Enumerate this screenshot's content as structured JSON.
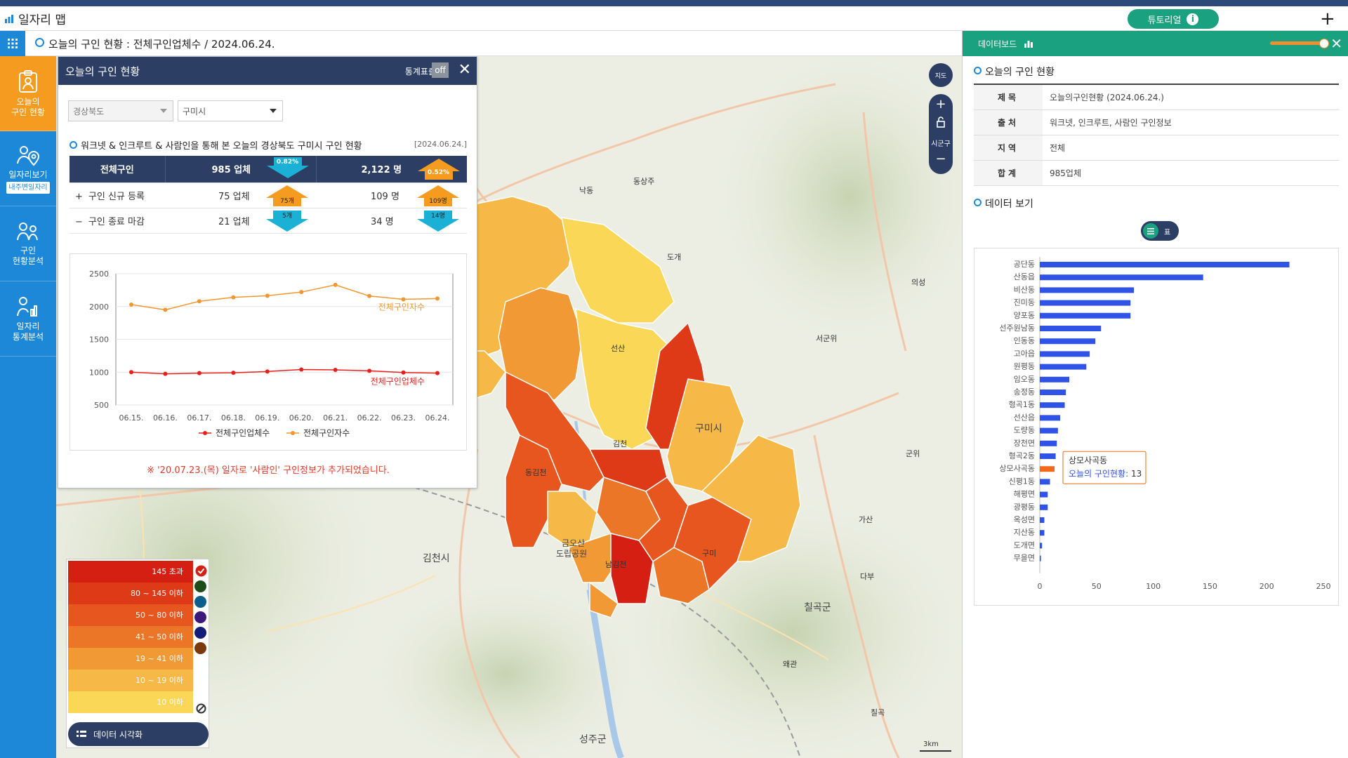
{
  "app": {
    "title": "일자리 맵",
    "tutorial_label": "튜토리얼",
    "info_icon": "i"
  },
  "breadcrumb": "오늘의 구인 현황 : 전체구인업체수 / 2024.06.24.",
  "sidebar": {
    "items": [
      {
        "label1": "오늘의",
        "label2": "구인 현황"
      },
      {
        "label1": "일자리보기",
        "badge": "내주변일자리"
      },
      {
        "label1": "구인",
        "label2": "현황분석"
      },
      {
        "label1": "일자리",
        "label2": "통계분석"
      }
    ]
  },
  "panel": {
    "title": "오늘의 구인 현황",
    "stat_label": "통계표출",
    "stat_toggle": "off",
    "region1": "경상북도",
    "region2": "구미시",
    "subtitle": "워크넷 & 인크루트 & 사람인을 통해 본 오늘의 경상북도 구미시 구인 현황",
    "date": "[2024.06.24.]",
    "table": {
      "header": {
        "label": "전체구인",
        "firms": "985 업체",
        "firms_change": "0.82%",
        "people": "2,122 명",
        "people_change": "0.52%"
      },
      "rows": [
        {
          "sign": "+",
          "label": "구인 신규 등록",
          "firms": "75 업체",
          "firms_badge": "75개",
          "people": "109 명",
          "people_badge": "109명"
        },
        {
          "sign": "−",
          "label": "구인 종료 마감",
          "firms": "21 업체",
          "firms_badge": "5개",
          "people": "34 명",
          "people_badge": "14명"
        }
      ]
    },
    "notice": "※ '20.07.23.(목) 일자로 '사람인' 구인정보가 추가되었습니다."
  },
  "chart_data": [
    {
      "type": "line",
      "categories": [
        "06.15.",
        "06.16.",
        "06.17.",
        "06.18.",
        "06.19.",
        "06.20.",
        "06.21.",
        "06.22.",
        "06.23.",
        "06.24."
      ],
      "series": [
        {
          "name": "전체구인업체수",
          "values": [
            1000,
            975,
            985,
            990,
            1010,
            1040,
            1035,
            1020,
            995,
            985
          ],
          "color": "#e8201c"
        },
        {
          "name": "전체구인자수",
          "values": [
            2030,
            1950,
            2080,
            2140,
            2165,
            2220,
            2330,
            2160,
            2110,
            2122
          ],
          "color": "#f2962f"
        }
      ],
      "yticks": [
        500,
        1000,
        1500,
        2000,
        2500
      ],
      "ylim": [
        500,
        2500
      ],
      "legend_position": "bottom",
      "grid": true
    },
    {
      "type": "bar",
      "orientation": "horizontal",
      "categories": [
        "공단동",
        "산동읍",
        "비산동",
        "진미동",
        "양포동",
        "선주원남동",
        "인동동",
        "고아읍",
        "원평동",
        "임오동",
        "송정동",
        "형곡1동",
        "선산읍",
        "도량동",
        "장천면",
        "형곡2동",
        "상모사곡동",
        "신평1동",
        "해평면",
        "광평동",
        "옥성면",
        "지산동",
        "도개면",
        "무을면"
      ],
      "values": [
        220,
        144,
        83,
        80,
        80,
        54,
        49,
        44,
        41,
        26,
        23,
        22,
        18,
        16,
        15,
        14,
        13,
        9,
        7,
        7,
        4,
        4,
        2,
        1
      ],
      "xticks": [
        0,
        50,
        100,
        150,
        200,
        250
      ],
      "xlim": [
        0,
        250
      ],
      "highlight": {
        "category": "상모사곡동",
        "label": "오늘의 구인현황",
        "value": "13"
      },
      "color": "#2f53e6",
      "highlight_color": "#f06a1a"
    }
  ],
  "legend": {
    "rows": [
      {
        "label": "145 초과",
        "color": "#d41f12"
      },
      {
        "label": "80 ~ 145 이하",
        "color": "#df3a17"
      },
      {
        "label": "50 ~ 80 이하",
        "color": "#e6561e"
      },
      {
        "label": "41 ~ 50 이하",
        "color": "#ec7627"
      },
      {
        "label": "19 ~ 41 이하",
        "color": "#f19a35"
      },
      {
        "label": "10 ~ 19 이하",
        "color": "#f6b947"
      },
      {
        "label": "10 이하",
        "color": "#fbd758"
      }
    ],
    "data_viz_button": "데이터 시각화"
  },
  "map": {
    "labels": {
      "city_gumi": "구미시",
      "city_gimcheon": "김천시",
      "county_chilgok": "칠곡군",
      "county_seongju": "성주군",
      "park": "금오산",
      "park2": "도립공원",
      "ic_gunwi": "서군위",
      "ic_uiseong": "의성",
      "ic_gunwi2": "군위",
      "ic_gasan": "가산",
      "ic_dabu": "다부",
      "ic_waegwan": "왜관",
      "ic_chilgok": "칠곡",
      "ic_gimcheon": "김천",
      "ic_donggimcheon": "동김천",
      "ic_namgimcheon": "남김천",
      "ic_nakdong": "낙동",
      "ic_sangju": "동상주",
      "ic_seonsan": "선산",
      "ic_dogae": "도개",
      "ic_gumi": "구미",
      "scale": "3km",
      "zoom_label": "시군구",
      "map_btn": "지도"
    }
  },
  "right_panel": {
    "title": "데이터보드",
    "section1": "오늘의 구인 현황",
    "info": [
      {
        "k": "제목",
        "v": "오늘의구인현황 (2024.06.24.)"
      },
      {
        "k": "출처",
        "v": "워크넷, 인크루트, 사람인 구인정보"
      },
      {
        "k": "지역",
        "v": "전체"
      },
      {
        "k": "합계",
        "v": "985업체"
      }
    ],
    "section2": "데이터 보기",
    "toggle_label": "표"
  }
}
